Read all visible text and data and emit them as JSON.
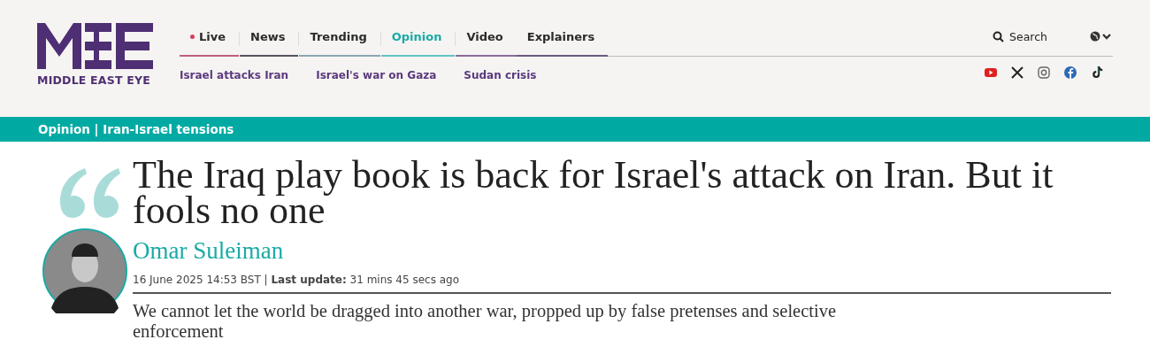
{
  "logo": {
    "wordmark": "MIDDLE EAST EYE"
  },
  "nav": [
    {
      "label": "Live",
      "kind": "live",
      "selected": false,
      "color": "#c0607a"
    },
    {
      "label": "News",
      "kind": "link",
      "selected": false,
      "color": "#55555f"
    },
    {
      "label": "Trending",
      "kind": "link",
      "selected": false,
      "color": "#8aa6b0"
    },
    {
      "label": "Opinion",
      "kind": "link",
      "selected": true,
      "color": "#62c3c5"
    },
    {
      "label": "Video",
      "kind": "link",
      "selected": false,
      "color": "#8a6a9a"
    },
    {
      "label": "Explainers",
      "kind": "link",
      "selected": false,
      "color": "#6a5a80"
    }
  ],
  "topics": [
    "Israel attacks Iran",
    "Israel's war on Gaza",
    "Sudan crisis"
  ],
  "search": {
    "label": "Search"
  },
  "social": [
    {
      "kind": "youtube"
    },
    {
      "kind": "x"
    },
    {
      "kind": "instagram"
    },
    {
      "kind": "facebook"
    },
    {
      "kind": "tiktok"
    }
  ],
  "section_bar": {
    "label": "Opinion | Iran-Israel tensions"
  },
  "article": {
    "headline": "The Iraq play book is back for Israel's attack on Iran. But it fools no one",
    "author": "Omar Suleiman",
    "published": "16 June 2025 14:53 BST",
    "separator": "|",
    "updated": "**Last update:** 31 mins 45 secs ago",
    "standfirst": "We cannot let the world be dragged into another war, propped up by false pretenses and selective enforcement"
  }
}
